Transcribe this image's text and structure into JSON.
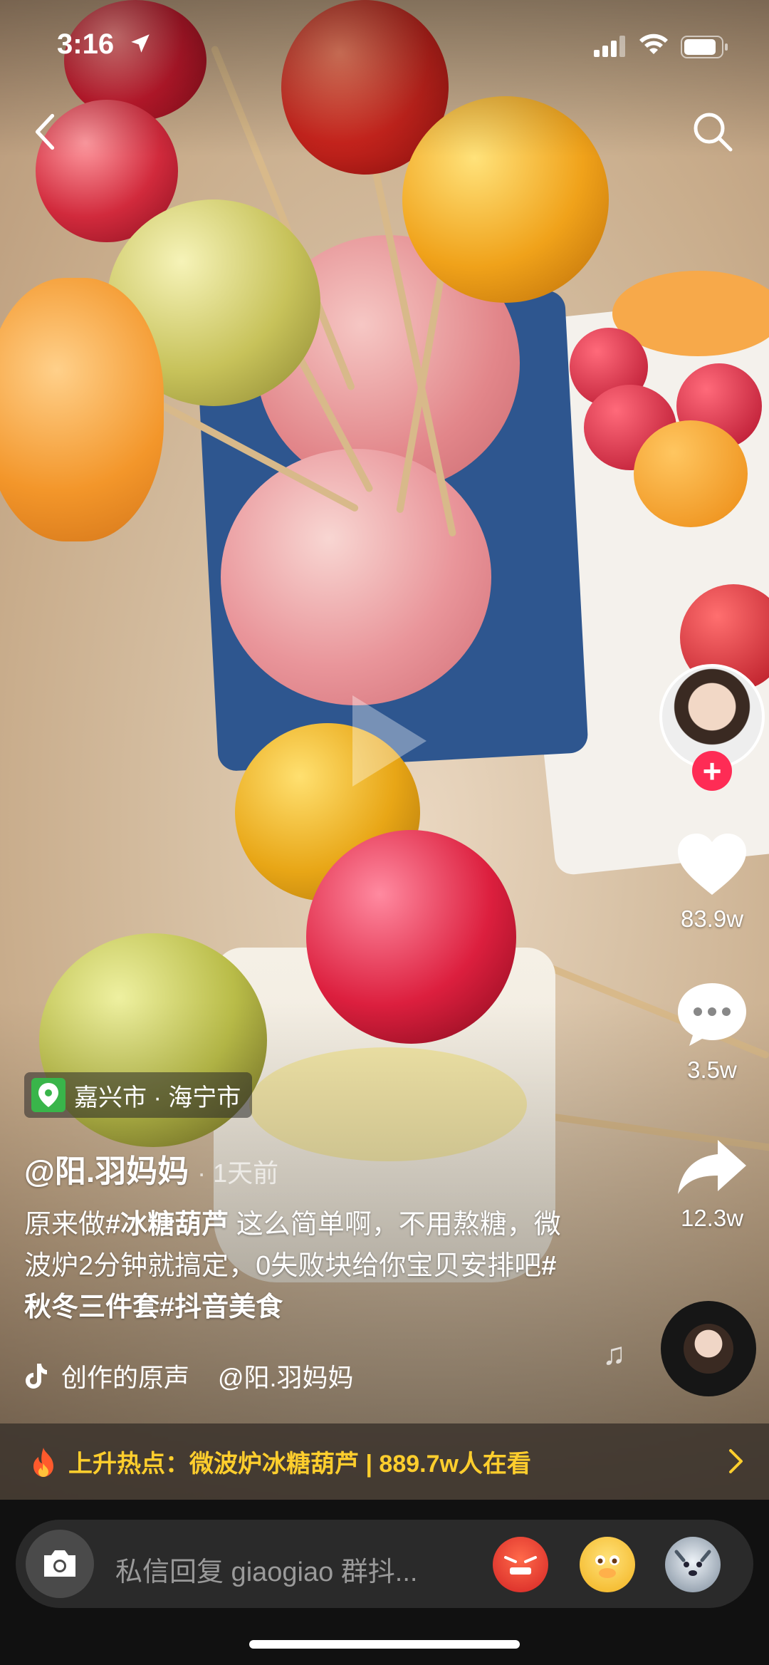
{
  "status_bar": {
    "time": "3:16"
  },
  "top_nav": {
    "back_icon": "chevron-left-icon",
    "search_icon": "search-icon"
  },
  "video": {
    "play_icon": "play-icon"
  },
  "right_rail": {
    "like_count": "83.9w",
    "comment_count": "3.5w",
    "share_count": "12.3w",
    "follow_symbol": "+"
  },
  "location": {
    "text": "嘉兴市 · 海宁市"
  },
  "post": {
    "author": "@阳.羽妈妈",
    "time_ago": "· 1天前",
    "description_parts": {
      "p1": "原来做",
      "tag1": "#冰糖葫芦",
      "p2": " 这么简单啊，不用熬糖，微波炉2分钟就搞定，0失败块给你宝贝安排吧",
      "tag2": "#秋冬三件套",
      "tag3": "#抖音美食"
    }
  },
  "music": {
    "text": "创作的原声    @阳.羽妈妈"
  },
  "hot_topic": {
    "text": "上升热点：微波炉冰糖葫芦 | 889.7w人在看"
  },
  "reply_bar": {
    "placeholder": "私信回复 giaogiao 群抖..."
  },
  "colors": {
    "follow_red": "#fe2c55",
    "hot_yellow": "#ffce2d",
    "location_green": "#39b54a"
  }
}
